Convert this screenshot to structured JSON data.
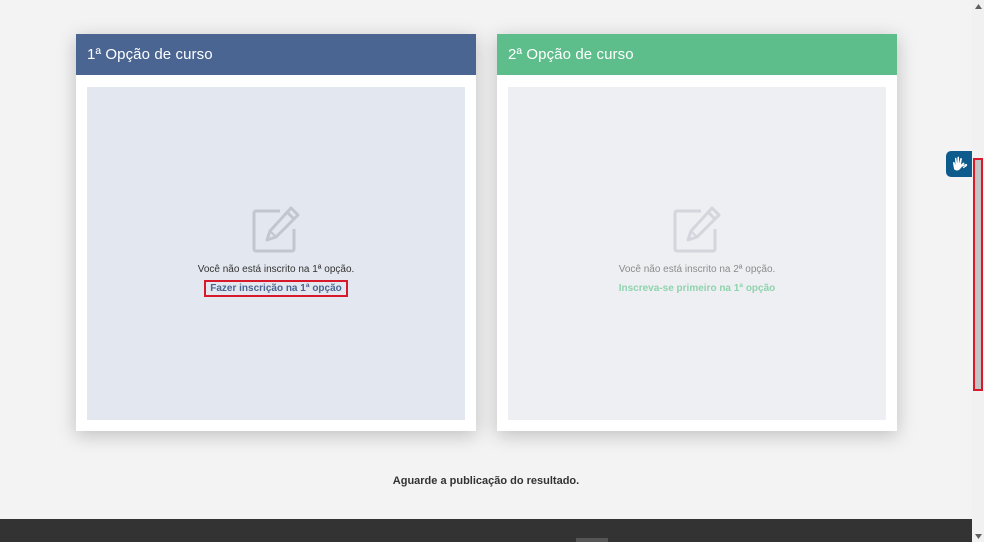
{
  "cards": [
    {
      "title": "1ª Opção de curso",
      "status": "Você não está inscrito na 1ª opção.",
      "action_label": "Fazer inscrição na 1ª opção",
      "icon": "edit-icon",
      "header_color": "#4a6592"
    },
    {
      "title": "2ª Opção de curso",
      "status": "Você não está inscrito na 2ª opção.",
      "action_label": "Inscreva-se primeiro na 1ª opção",
      "icon": "edit-icon",
      "header_color": "#5dbd8b"
    }
  ],
  "result_note": "Aguarde a publicação do resultado.",
  "accessibility_widget": {
    "icon": "sign-language-hands-icon",
    "color": "#0d5a8c"
  },
  "colors": {
    "highlight": "#d7192b",
    "footer": "#333333",
    "page_background": "#f3f3f3"
  }
}
